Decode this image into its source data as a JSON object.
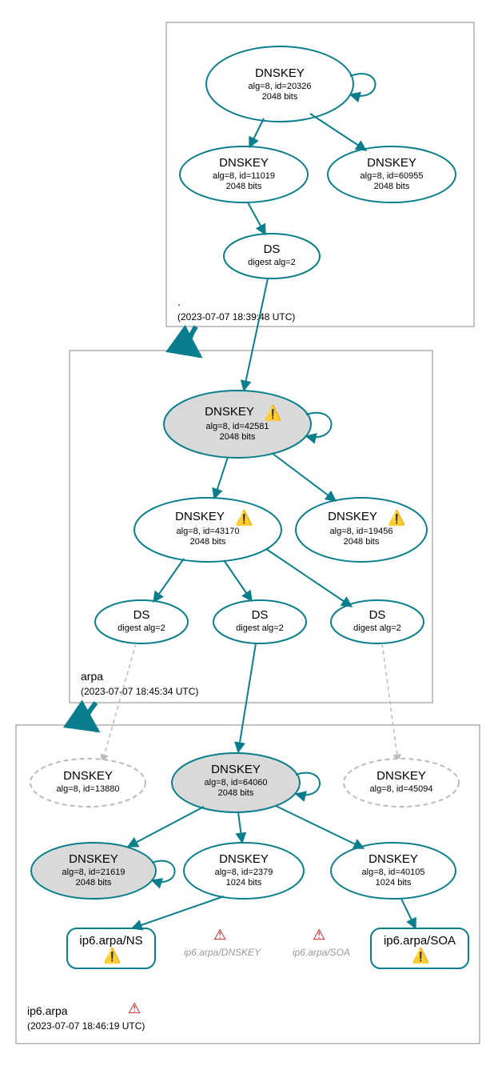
{
  "zones": {
    "root": {
      "label": ".",
      "timestamp": "(2023-07-07 18:39:48 UTC)"
    },
    "arpa": {
      "label": "arpa",
      "timestamp": "(2023-07-07 18:45:34 UTC)"
    },
    "ip6": {
      "label": "ip6.arpa",
      "timestamp": "(2023-07-07 18:46:19 UTC)"
    }
  },
  "nodes": {
    "root_dnskey_20326": {
      "title": "DNSKEY",
      "line2": "alg=8, id=20326",
      "line3": "2048 bits"
    },
    "root_dnskey_11019": {
      "title": "DNSKEY",
      "line2": "alg=8, id=11019",
      "line3": "2048 bits"
    },
    "root_dnskey_60955": {
      "title": "DNSKEY",
      "line2": "alg=8, id=60955",
      "line3": "2048 bits"
    },
    "root_ds": {
      "title": "DS",
      "line2": "digest alg=2"
    },
    "arpa_dnskey_42581": {
      "title": "DNSKEY",
      "line2": "alg=8, id=42581",
      "line3": "2048 bits"
    },
    "arpa_dnskey_43170": {
      "title": "DNSKEY",
      "line2": "alg=8, id=43170",
      "line3": "2048 bits"
    },
    "arpa_dnskey_19456": {
      "title": "DNSKEY",
      "line2": "alg=8, id=19456",
      "line3": "2048 bits"
    },
    "arpa_ds_1": {
      "title": "DS",
      "line2": "digest alg=2"
    },
    "arpa_ds_2": {
      "title": "DS",
      "line2": "digest alg=2"
    },
    "arpa_ds_3": {
      "title": "DS",
      "line2": "digest alg=2"
    },
    "ip6_dnskey_13880": {
      "title": "DNSKEY",
      "line2": "alg=8, id=13880"
    },
    "ip6_dnskey_64060": {
      "title": "DNSKEY",
      "line2": "alg=8, id=64060",
      "line3": "2048 bits"
    },
    "ip6_dnskey_45094": {
      "title": "DNSKEY",
      "line2": "alg=8, id=45094"
    },
    "ip6_dnskey_21619": {
      "title": "DNSKEY",
      "line2": "alg=8, id=21619",
      "line3": "2048 bits"
    },
    "ip6_dnskey_2379": {
      "title": "DNSKEY",
      "line2": "alg=8, id=2379",
      "line3": "1024 bits"
    },
    "ip6_dnskey_40105": {
      "title": "DNSKEY",
      "line2": "alg=8, id=40105",
      "line3": "1024 bits"
    },
    "ip6_ns": {
      "title": "ip6.arpa/NS"
    },
    "ip6_dnskey_rec": {
      "title": "ip6.arpa/DNSKEY"
    },
    "ip6_soa_rec": {
      "title": "ip6.arpa/SOA"
    },
    "ip6_soa": {
      "title": "ip6.arpa/SOA"
    }
  },
  "icons": {
    "warn_yellow": "⚠️",
    "warn_red": "⚠️"
  }
}
